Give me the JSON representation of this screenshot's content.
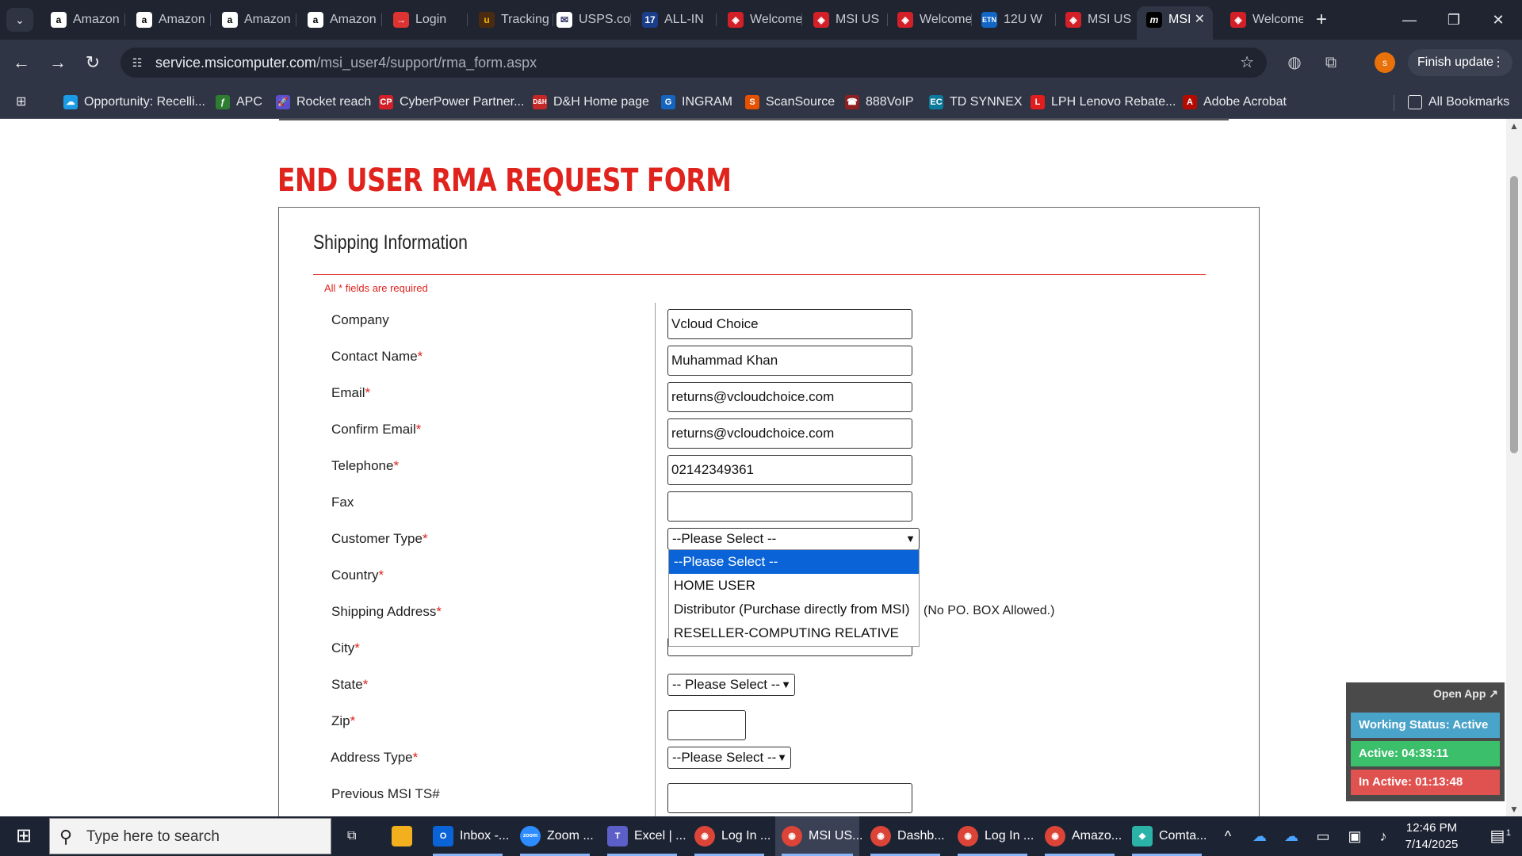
{
  "browser": {
    "tabs": [
      {
        "label": "Amazon",
        "icon": "amazon-icon"
      },
      {
        "label": "Amazon",
        "icon": "amazon-icon"
      },
      {
        "label": "Amazon",
        "icon": "amazon-icon"
      },
      {
        "label": "Amazon",
        "icon": "amazon-icon"
      },
      {
        "label": "Login",
        "icon": "login-icon"
      },
      {
        "label": "Tracking",
        "icon": "ups-icon"
      },
      {
        "label": "USPS.com",
        "icon": "usps-icon"
      },
      {
        "label": "ALL-IN",
        "icon": "17track-icon"
      },
      {
        "label": "Welcome",
        "icon": "msi-shield-icon"
      },
      {
        "label": "MSI US",
        "icon": "msi-shield-icon"
      },
      {
        "label": "Welcome",
        "icon": "msi-shield-icon"
      },
      {
        "label": "12U W",
        "icon": "etn-icon"
      },
      {
        "label": "MSI US",
        "icon": "msi-shield-icon"
      },
      {
        "label": "MSI",
        "icon": "msi-logo-icon"
      },
      {
        "label": "Welcome",
        "icon": "msi-shield-icon"
      }
    ],
    "url_host": "service.msicomputer.com",
    "url_path": "/msi_user4/support/rma_form.aspx",
    "profile_initial": "s",
    "finish_update_label": "Finish update",
    "bookmarks": [
      "Opportunity: Recelli...",
      "APC",
      "Rocket reach",
      "CyberPower Partner...",
      "D&H Home page",
      "INGRAM",
      "ScanSource",
      "888VoIP",
      "TD SYNNEX",
      "LPH Lenovo Rebate...",
      "Adobe Acrobat"
    ],
    "all_bookmarks_label": "All Bookmarks"
  },
  "page": {
    "title": "END USER RMA REQUEST FORM",
    "section_title": "Shipping Information",
    "required_note": "All * fields are required",
    "fields": {
      "company": {
        "label": "Company",
        "value": "Vcloud Choice"
      },
      "contact_name": {
        "label": "Contact Name",
        "value": "Muhammad Khan"
      },
      "email": {
        "label": "Email",
        "value": "returns@vcloudchoice.com"
      },
      "confirm_email": {
        "label": "Confirm Email",
        "value": "returns@vcloudchoice.com"
      },
      "telephone": {
        "label": "Telephone",
        "value": "02142349361"
      },
      "fax": {
        "label": "Fax",
        "value": ""
      },
      "customer_type": {
        "label": "Customer Type",
        "value": "--Please Select --"
      },
      "country": {
        "label": "Country"
      },
      "shipping_address": {
        "label": "Shipping Address"
      },
      "city": {
        "label": "City",
        "value": ""
      },
      "state": {
        "label": "State",
        "value": "-- Please Select --"
      },
      "zip": {
        "label": "Zip",
        "value": ""
      },
      "address_type": {
        "label": "Address Type",
        "value": "--Please Select --"
      },
      "previous_ts": {
        "label": "Previous MSI TS#",
        "value": ""
      }
    },
    "required_star": "*",
    "customer_type_options": [
      "--Please Select --",
      "HOME USER",
      "Distributor (Purchase directly from MSI)",
      "RESELLER-COMPUTING RELATIVE"
    ],
    "po_box_note": "(No PO. BOX Allowed.)"
  },
  "widget": {
    "open_app": "Open App ↗",
    "working_status": "Working Status: Active",
    "active": "Active: 04:33:11",
    "inactive": "In Active: 01:13:48"
  },
  "taskbar": {
    "search_placeholder": "Type here to search",
    "apps": [
      {
        "label": "Inbox -...",
        "icon": "outlook-icon"
      },
      {
        "label": "Zoom ...",
        "icon": "zoom-icon"
      },
      {
        "label": "Excel | ...",
        "icon": "teams-icon"
      },
      {
        "label": "Log In ...",
        "icon": "chrome-icon"
      },
      {
        "label": "MSI US...",
        "icon": "chrome-icon"
      },
      {
        "label": "Dashb...",
        "icon": "chrome-icon"
      },
      {
        "label": "Log In ...",
        "icon": "chrome-icon"
      },
      {
        "label": "Amazo...",
        "icon": "chrome-icon"
      },
      {
        "label": "Comta...",
        "icon": "comtalk-icon"
      }
    ],
    "time": "12:46 PM",
    "date": "7/14/2025",
    "notifications_count": "1"
  },
  "colors": {
    "title_red": "#e0231d",
    "highlight_blue": "#0a64d8",
    "widget_active_blue": "#4aa3c8",
    "widget_active_green": "#3cbf6a",
    "widget_inactive_red": "#e0524f"
  }
}
